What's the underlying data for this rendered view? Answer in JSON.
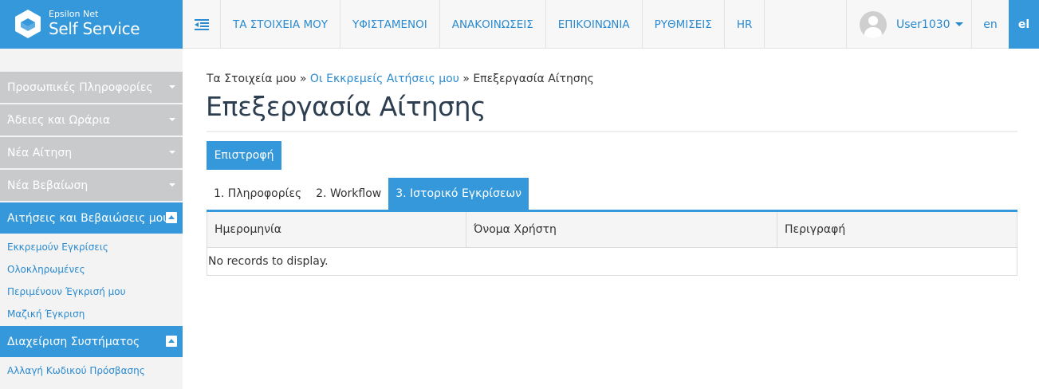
{
  "brand": {
    "line1": "Epsilon Net",
    "line2": "Self Service",
    "color": "#3498db"
  },
  "nav": {
    "items": [
      {
        "label": "ΤΑ ΣΤΟΙΧΕΙΑ ΜΟΥ"
      },
      {
        "label": "ΥΦΙΣΤΑΜΕΝΟΙ"
      },
      {
        "label": "ΑΝΑΚΟΙΝΩΣΕΙΣ"
      },
      {
        "label": "ΕΠΙΚΟΙΝΩΝΙΑ"
      },
      {
        "label": "ΡΥΘΜΙΣΕΙΣ"
      },
      {
        "label": "HR"
      }
    ]
  },
  "user": {
    "name": "User1030"
  },
  "languages": {
    "en": "en",
    "el": "el"
  },
  "sidebar": {
    "sections": [
      {
        "label": "Προσωπικές Πληροφορίες"
      },
      {
        "label": "Άδειες και Ωράρια"
      },
      {
        "label": "Νέα Αίτηση"
      },
      {
        "label": "Νέα Βεβαίωση"
      },
      {
        "label": "Αιτήσεις και Βεβαιώσεις μου"
      },
      {
        "label": "Διαχείριση Συστήματος"
      }
    ],
    "links": [
      {
        "label": "Εκκρεμούν Εγκρίσεις"
      },
      {
        "label": "Ολοκληρωμένες"
      },
      {
        "label": "Περιμένουν Έγκρισή μου"
      },
      {
        "label": "Μαζική Έγκριση"
      },
      {
        "label": "Αλλαγή Κωδικού Πρόσβασης"
      }
    ]
  },
  "breadcrumb": {
    "root": "Τα Στοιχεία μου",
    "sep": " » ",
    "middle": "Οι Εκκρεμείς Αιτήσεις μου",
    "current": "Επεξεργασία Αίτησης"
  },
  "page": {
    "title": "Επεξεργασία Αίτησης",
    "back_label": "Επιστροφή"
  },
  "tabs": [
    {
      "label": "1. Πληροφορίες"
    },
    {
      "label": "2. Workflow"
    },
    {
      "label": "3. Ιστορικό Εγκρίσεων"
    }
  ],
  "grid": {
    "columns": [
      "Ημερομηνία",
      "Όνομα Χρήστη",
      "Περιγραφή"
    ],
    "empty_text": "No records to display."
  }
}
